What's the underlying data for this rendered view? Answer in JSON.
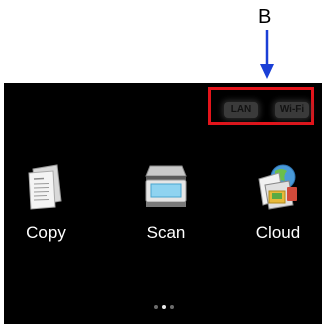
{
  "annotation": {
    "label": "B"
  },
  "status_bar": {
    "lan_label": "LAN",
    "wifi_label": "Wi-Fi"
  },
  "apps": [
    {
      "label": "Copy",
      "icon": "copy-icon"
    },
    {
      "label": "Scan",
      "icon": "scan-icon"
    },
    {
      "label": "Cloud",
      "icon": "cloud-icon"
    }
  ],
  "pager": {
    "pages": 3,
    "current": 2
  },
  "colors": {
    "screen_bg": "#000000",
    "highlight": "#e4141b",
    "arrow": "#1a3fd6",
    "label_text": "#ffffff"
  }
}
